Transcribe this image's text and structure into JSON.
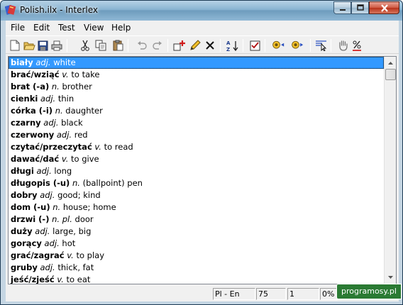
{
  "window": {
    "title": "Polish.ilx - Interlex"
  },
  "menu": [
    "File",
    "Edit",
    "Test",
    "View",
    "Help"
  ],
  "toolbar": {
    "icons": [
      "new-file-icon",
      "open-folder-icon",
      "save-icon",
      "print-icon",
      "cut-icon",
      "copy-icon",
      "paste-icon",
      "undo-icon",
      "redo-icon",
      "add-entry-icon",
      "edit-pencil-icon",
      "delete-icon",
      "sort-az-icon",
      "test-checklist-icon",
      "voice-left-icon",
      "voice-right-icon",
      "select-cursor-icon",
      "hand-icon",
      "percent-icon"
    ]
  },
  "entries": [
    {
      "headword": "biały",
      "pos": "adj.",
      "meaning": "white"
    },
    {
      "headword": "brać/wziąć",
      "pos": "v.",
      "meaning": "to take"
    },
    {
      "headword": "brat (-a)",
      "pos": "n.",
      "meaning": "brother"
    },
    {
      "headword": "cienki",
      "pos": "adj.",
      "meaning": "thin"
    },
    {
      "headword": "córka (-i)",
      "pos": "n.",
      "meaning": "daughter"
    },
    {
      "headword": "czarny",
      "pos": "adj.",
      "meaning": "black"
    },
    {
      "headword": "czerwony",
      "pos": "adj.",
      "meaning": "red"
    },
    {
      "headword": "czytać/przeczytać",
      "pos": "v.",
      "meaning": "to read"
    },
    {
      "headword": "dawać/dać",
      "pos": "v.",
      "meaning": "to give"
    },
    {
      "headword": "długi",
      "pos": "adj.",
      "meaning": "long"
    },
    {
      "headword": "długopis (-u)",
      "pos": "n.",
      "meaning": "(ballpoint) pen"
    },
    {
      "headword": "dobry",
      "pos": "adj.",
      "meaning": "good; kind"
    },
    {
      "headword": "dom (-u)",
      "pos": "n.",
      "meaning": "house; home"
    },
    {
      "headword": "drzwi (-)",
      "pos": "n. pl.",
      "meaning": "door"
    },
    {
      "headword": "duży",
      "pos": "adj.",
      "meaning": "large, big"
    },
    {
      "headword": "gorący",
      "pos": "adj.",
      "meaning": "hot"
    },
    {
      "headword": "grać/zagrać",
      "pos": "v.",
      "meaning": "to play"
    },
    {
      "headword": "gruby",
      "pos": "adj.",
      "meaning": "thick, fat"
    },
    {
      "headword": "jeść/zjeść",
      "pos": "v.",
      "meaning": "to eat"
    }
  ],
  "status": {
    "lang_pair": "Pl - En",
    "count": "75",
    "position": "1",
    "percent": "0%"
  },
  "watermark": "programosy.pl"
}
